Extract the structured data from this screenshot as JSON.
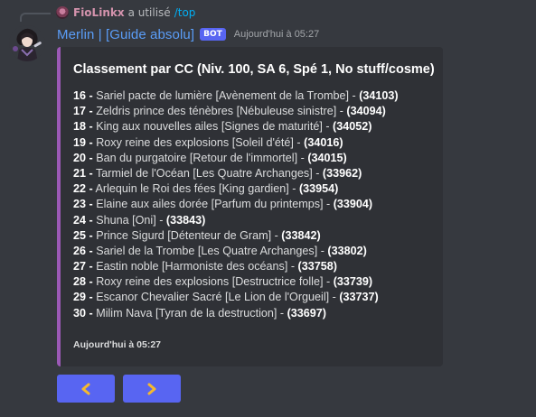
{
  "reply": {
    "username": "FioLinkx",
    "text": "a utilisé",
    "command": "/top"
  },
  "message": {
    "author": "Merlin | [Guide absolu]",
    "badge": "BOT",
    "timestamp": "Aujourd'hui à 05:27"
  },
  "embed": {
    "color": "#9b59b6",
    "title": "Classement par CC (Niv. 100, SA 6, Spé 1, No stuff/cosme)",
    "rows": [
      {
        "rank": "16 -",
        "name": "Sariel pacte de lumière [Avènement de la Trombe] -",
        "score": "(34103)"
      },
      {
        "rank": "17 -",
        "name": "Zeldris prince des ténèbres [Nébuleuse sinistre] -",
        "score": "(34094)"
      },
      {
        "rank": "18 -",
        "name": "King aux nouvelles ailes [Signes de maturité] -",
        "score": "(34052)"
      },
      {
        "rank": "19 -",
        "name": "Roxy reine des explosions [Soleil d'été] -",
        "score": "(34016)"
      },
      {
        "rank": "20 -",
        "name": "Ban du purgatoire [Retour de l'immortel] -",
        "score": "(34015)"
      },
      {
        "rank": "21 -",
        "name": "Tarmiel de l'Océan [Les Quatre Archanges] -",
        "score": "(33962)"
      },
      {
        "rank": "22 -",
        "name": "Arlequin le Roi des fées [King gardien] -",
        "score": "(33954)"
      },
      {
        "rank": "23 -",
        "name": "Elaine aux ailes dorée [Parfum du printemps] -",
        "score": "(33904)"
      },
      {
        "rank": "24 -",
        "name": "Shuna [Oni] -",
        "score": "(33843)"
      },
      {
        "rank": "25 -",
        "name": "Prince Sigurd [Détenteur de Gram] -",
        "score": "(33842)"
      },
      {
        "rank": "26 -",
        "name": "Sariel de la Trombe [Les Quatre Archanges] -",
        "score": "(33802)"
      },
      {
        "rank": "27 -",
        "name": "Eastin noble [Harmoniste des océans] -",
        "score": "(33758)"
      },
      {
        "rank": "28 -",
        "name": "Roxy reine des explosions [Destructrice folle] -",
        "score": "(33739)"
      },
      {
        "rank": "29 -",
        "name": "Escanor Chevalier Sacré [Le Lion de l'Orgueil] -",
        "score": "(33737)"
      },
      {
        "rank": "30 -",
        "name": "Milim Nava [Tyran de la destruction] -",
        "score": "(33697)"
      }
    ],
    "footer": "Aujourd'hui à 05:27"
  },
  "buttons": {
    "prev_icon": "arrow-left-icon",
    "next_icon": "arrow-right-icon",
    "color": "#5865f2",
    "arrow_color": "#f5b92e"
  }
}
